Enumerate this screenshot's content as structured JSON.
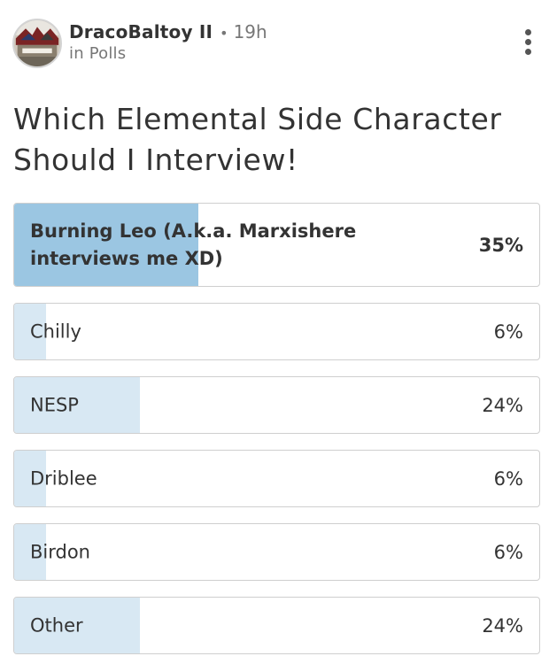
{
  "post": {
    "author": "DracoBaltoy II",
    "separator": "•",
    "time": "19h",
    "category": "in Polls",
    "title": "Which Elemental Side Character Should I Interview!"
  },
  "poll": {
    "options": [
      {
        "label": "Burning Leo (A.k.a. Marxishere interviews me XD)",
        "percent_text": "35%",
        "percent": 35,
        "leading": true
      },
      {
        "label": "Chilly",
        "percent_text": "6%",
        "percent": 6,
        "leading": false
      },
      {
        "label": "NESP",
        "percent_text": "24%",
        "percent": 24,
        "leading": false
      },
      {
        "label": "Driblee",
        "percent_text": "6%",
        "percent": 6,
        "leading": false
      },
      {
        "label": "Birdon",
        "percent_text": "6%",
        "percent": 6,
        "leading": false
      },
      {
        "label": "Other",
        "percent_text": "24%",
        "percent": 24,
        "leading": false
      }
    ]
  },
  "icons": {
    "more": "more-vertical-icon"
  },
  "colors": {
    "leading_fill": "#9bc6e2",
    "result_fill": "#d8e8f3",
    "text": "#333333",
    "muted_text": "#777777"
  }
}
